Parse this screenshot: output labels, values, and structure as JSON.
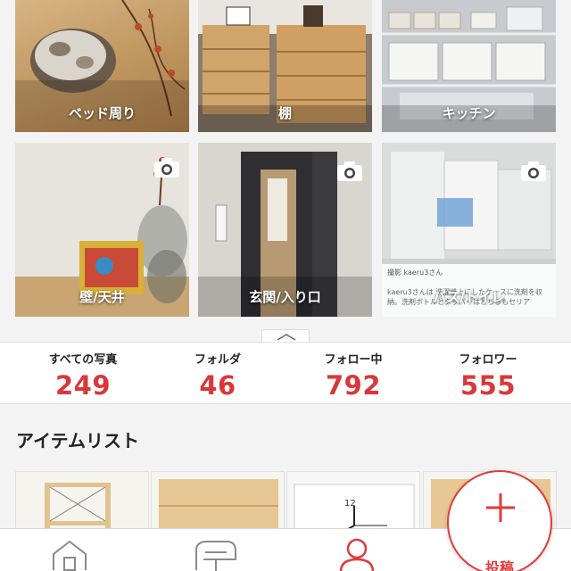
{
  "folders": [
    {
      "label": "ベッド周り"
    },
    {
      "label": "棚"
    },
    {
      "label": "キッチン"
    },
    {
      "label": "壁/天井"
    },
    {
      "label": "玄関/入り口"
    },
    {
      "label": "バス/トイレ",
      "overlay_user": "撮影 kaeru3さん",
      "overlay_caption": "kaeru3さんは 洗濯機上にしたケースに洗剤を収納。洗剤ボトルとタッパーはどちらもセリア"
    }
  ],
  "stats": [
    {
      "label": "すべての写真",
      "value": "249"
    },
    {
      "label": "フォルダ",
      "value": "46"
    },
    {
      "label": "フォロー中",
      "value": "792"
    },
    {
      "label": "フォロワー",
      "value": "555"
    }
  ],
  "items_section": {
    "title": "アイテムリスト"
  },
  "clock_number": "12",
  "post_button": {
    "label": "投稿"
  },
  "nav": [
    "home-icon",
    "mailbox-icon",
    "profile-icon"
  ],
  "colors": {
    "accent": "#e23a3c",
    "stat_number": "#d9383a"
  }
}
